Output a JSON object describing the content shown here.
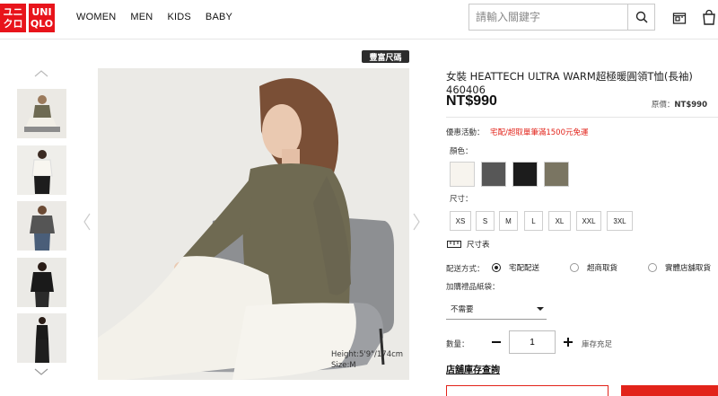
{
  "brand": {
    "logo_left": "ユニ\nクロ",
    "logo_right": "UNI\nQLO",
    "red": "#e2231a"
  },
  "nav": [
    {
      "label": "WOMEN"
    },
    {
      "label": "MEN"
    },
    {
      "label": "KIDS"
    },
    {
      "label": "BABY"
    }
  ],
  "search": {
    "placeholder": "請輸入關鍵字",
    "icon": "search-icon"
  },
  "header_icons": [
    "store-icon",
    "cart-icon"
  ],
  "gallery": {
    "badge": "豐富尺碼",
    "model_height": "Height:5'9\"/174cm",
    "model_size": "Size:M",
    "thumb_count": 5
  },
  "product": {
    "title": "女裝 HEATTECH ULTRA WARM超極暖圓領T恤(長袖) 460406",
    "price": "NT$990",
    "orig_label": "原價：",
    "orig_price": "NT$990",
    "promo_label": "優惠活動：",
    "promo_text": "宅配/超取單筆滿1500元免運",
    "color_label": "顏色：",
    "colors": [
      "#f7f4ee",
      "#575757",
      "#1c1c1c",
      "#7a7562"
    ],
    "size_label": "尺寸：",
    "sizes": [
      "XS",
      "S",
      "M",
      "L",
      "XL",
      "XXL",
      "3XL"
    ],
    "size_chart": "尺寸表",
    "shipping_label": "配送方式：",
    "shipping_options": [
      {
        "label": "宅配配送",
        "selected": true
      },
      {
        "label": "超商取貨",
        "selected": false
      },
      {
        "label": "實體店舖取貨",
        "selected": false
      }
    ],
    "gift_label": "加購禮品紙袋：",
    "gift_selected": "不需要",
    "qty_label": "數量：",
    "qty_value": "1",
    "stock_text": "庫存充足",
    "inventory_link": "店舖庫存查詢"
  }
}
